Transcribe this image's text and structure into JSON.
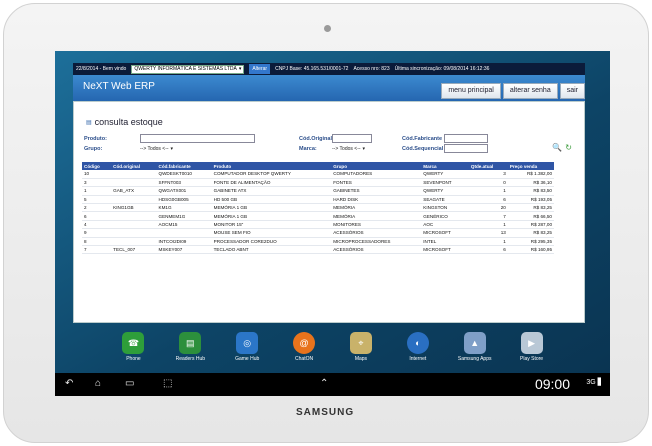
{
  "status_bar": {
    "date": "22/8/2014 - Bem vindo",
    "company_select": "QWERTY INFORMÁTICA E SISTEMAS LTDA",
    "change_button": "Alterar",
    "cnpj": "CNPJ Base: 45.165.531/0001-72",
    "access": "Acesso nro: 823",
    "last_sync": "Última sincronização: 09/08/2014 16:12:36"
  },
  "app": {
    "title": "NeXT Web ERP",
    "tabs": [
      "menu principal",
      "alterar senha",
      "sair"
    ]
  },
  "page": {
    "title": "consulta estoque",
    "filters": {
      "produto_label": "Produto:",
      "grupo_label": "Grupo:",
      "grupo_value": "--> Todos <--",
      "cod_original_label": "Cód.Original",
      "marca_label": "Marca:",
      "marca_value": "--> Todos <--",
      "cod_fabricante_label": "Cód.Fabricante",
      "cod_sequencial_label": "Cód.Sequencial"
    }
  },
  "table": {
    "headers": [
      "Código",
      "Cód.original",
      "Cód.fabricante",
      "Produto",
      "Grupo",
      "Marca",
      "Qtde.atual",
      "Preço venda"
    ],
    "rows": [
      [
        "10",
        "",
        "QWDESKT0010",
        "COMPUTADOR DESKTOP QWERTY",
        "COMPUTADORES",
        "QWERTY",
        "3",
        "R$ 1.382,00"
      ],
      [
        "3",
        "",
        "SFFNT003",
        "FONTE DE ALIMENTAÇÃO",
        "FONTES",
        "SEVENPONT",
        "0",
        "R$ 36,10"
      ],
      [
        "1",
        "GAB_ATX",
        "QWGATX001",
        "GABINETE ATX",
        "GABINETES",
        "QWERTY",
        "1",
        "R$ 83,50"
      ],
      [
        "5",
        "",
        "HDSG0GB005",
        "HD 500 GB",
        "HARD DISK",
        "SEAGATE",
        "6",
        "R$ 193,05"
      ],
      [
        "2",
        "KING1GB",
        "KM1G",
        "MEMÓRIA 1 GB",
        "MEMÓRIA",
        "KINGSTON",
        "20",
        "R$ 83,25"
      ],
      [
        "6",
        "",
        "GENMEM1G",
        "MEMÓRIA 1 GB",
        "MEMÓRIA",
        "GENÉRICO",
        "7",
        "R$ 66,50"
      ],
      [
        "4",
        "",
        "AOCM15",
        "MONITOR 15\"",
        "MONITORES",
        "AOC",
        "1",
        "R$ 287,00"
      ],
      [
        "9",
        "",
        "",
        "MOUSE SEM FIO",
        "ACESSÓRIOS",
        "MICROSOFT",
        "13",
        "R$ 83,25"
      ],
      [
        "8",
        "",
        "INTCOI2DI09",
        "PROCESSADOR CORE2DUO",
        "MICROPROCESSADORES",
        "INTEL",
        "1",
        "R$ 295,35"
      ],
      [
        "7",
        "TECL_007",
        "MSKEY007",
        "TECLADO ABNT",
        "ACESSÓRIOS",
        "MICROSOFT",
        "6",
        "R$ 160,95"
      ]
    ]
  },
  "dock": {
    "apps": [
      {
        "label": "Phone",
        "icon": "phone-icon",
        "color": "#2e9e3a"
      },
      {
        "label": "Readers Hub",
        "icon": "book-icon",
        "color": "#2c8f3c"
      },
      {
        "label": "Game Hub",
        "icon": "gamepad-icon",
        "color": "#2b76c8"
      },
      {
        "label": "ChatON",
        "icon": "chat-icon",
        "color": "#e8731c"
      },
      {
        "label": "Maps",
        "icon": "map-icon",
        "color": "#c9b26a"
      },
      {
        "label": "Internet",
        "icon": "globe-icon",
        "color": "#2a6fc2"
      },
      {
        "label": "Samsung Apps",
        "icon": "apps-icon",
        "color": "#7f9fc8"
      },
      {
        "label": "Play Store",
        "icon": "play-store-icon",
        "color": "#b9c8d6"
      }
    ]
  },
  "system_bar": {
    "time": "09:00",
    "signal": "3G"
  },
  "device": {
    "brand": "SAMSUNG"
  }
}
